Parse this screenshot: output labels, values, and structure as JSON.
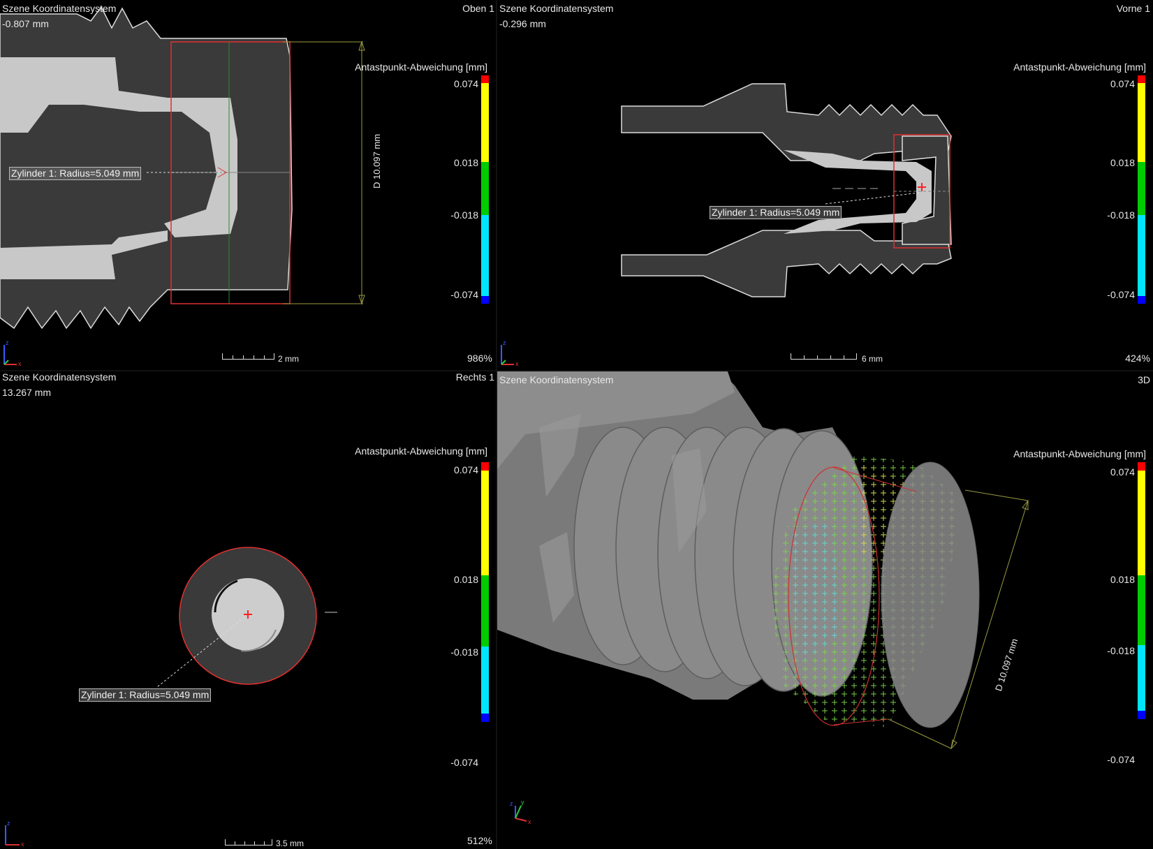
{
  "viewports": {
    "top_left": {
      "coord_system": "Szene Koordinatensystem",
      "slice_pos": "-0.807 mm",
      "view_name": "Oben 1",
      "zoom": "986%",
      "scale": "2 mm",
      "dimension": "D 10.097 mm",
      "callout": "Zylinder 1: Radius=5.049 mm"
    },
    "top_right": {
      "coord_system": "Szene Koordinatensystem",
      "slice_pos": "-0.296 mm",
      "view_name": "Vorne 1",
      "zoom": "424%",
      "scale": "6 mm",
      "callout": "Zylinder 1: Radius=5.049 mm"
    },
    "bottom_left": {
      "coord_system": "Szene Koordinatensystem",
      "slice_pos": "13.267 mm",
      "view_name": "Rechts 1",
      "zoom": "512%",
      "scale": "3.5 mm",
      "callout": "Zylinder 1: Radius=5.049 mm"
    },
    "bottom_right": {
      "coord_system": "Szene Koordinatensystem",
      "view_name": "3D",
      "dimension": "D 10.097 mm"
    }
  },
  "legend": {
    "title": "Antastpunkt-Abweichung [mm]",
    "ticks": [
      "0.074",
      "0.018",
      "-0.018",
      "-0.074"
    ],
    "colors": {
      "over": "#ff0000",
      "high": "#ffff00",
      "mid": "#00cc00",
      "low": "#00e5ff",
      "under": "#0000ff"
    }
  },
  "axes": {
    "x": "x",
    "y": "y",
    "z": "z"
  }
}
